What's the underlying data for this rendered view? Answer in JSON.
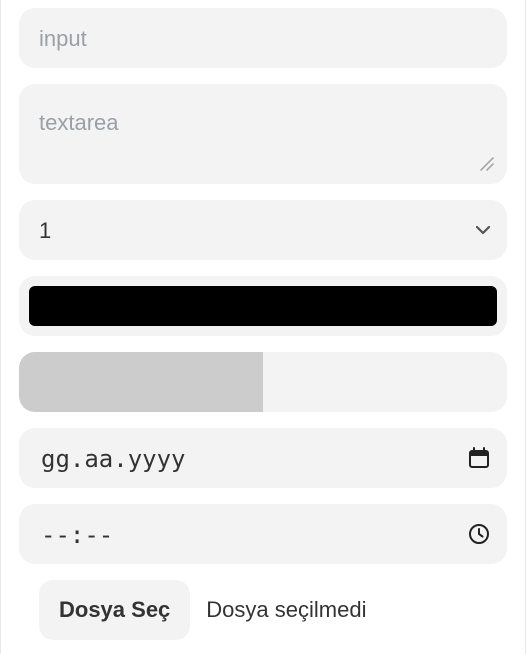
{
  "input": {
    "placeholder": "input"
  },
  "textarea": {
    "placeholder": "textarea"
  },
  "select": {
    "value": "1"
  },
  "color": {
    "value": "#000000"
  },
  "range": {
    "value": 50,
    "min": 0,
    "max": 100
  },
  "date": {
    "value": "gg.aa.yyyy",
    "icon": "calendar-icon"
  },
  "time": {
    "value": "--:--",
    "icon": "clock-icon"
  },
  "file": {
    "button_label": "Dosya Seç",
    "status": "Dosya seçilmedi"
  },
  "colors": {
    "field_bg": "#f3f3f3",
    "range_fill": "#cccccc",
    "placeholder": "#9aa0a8"
  }
}
